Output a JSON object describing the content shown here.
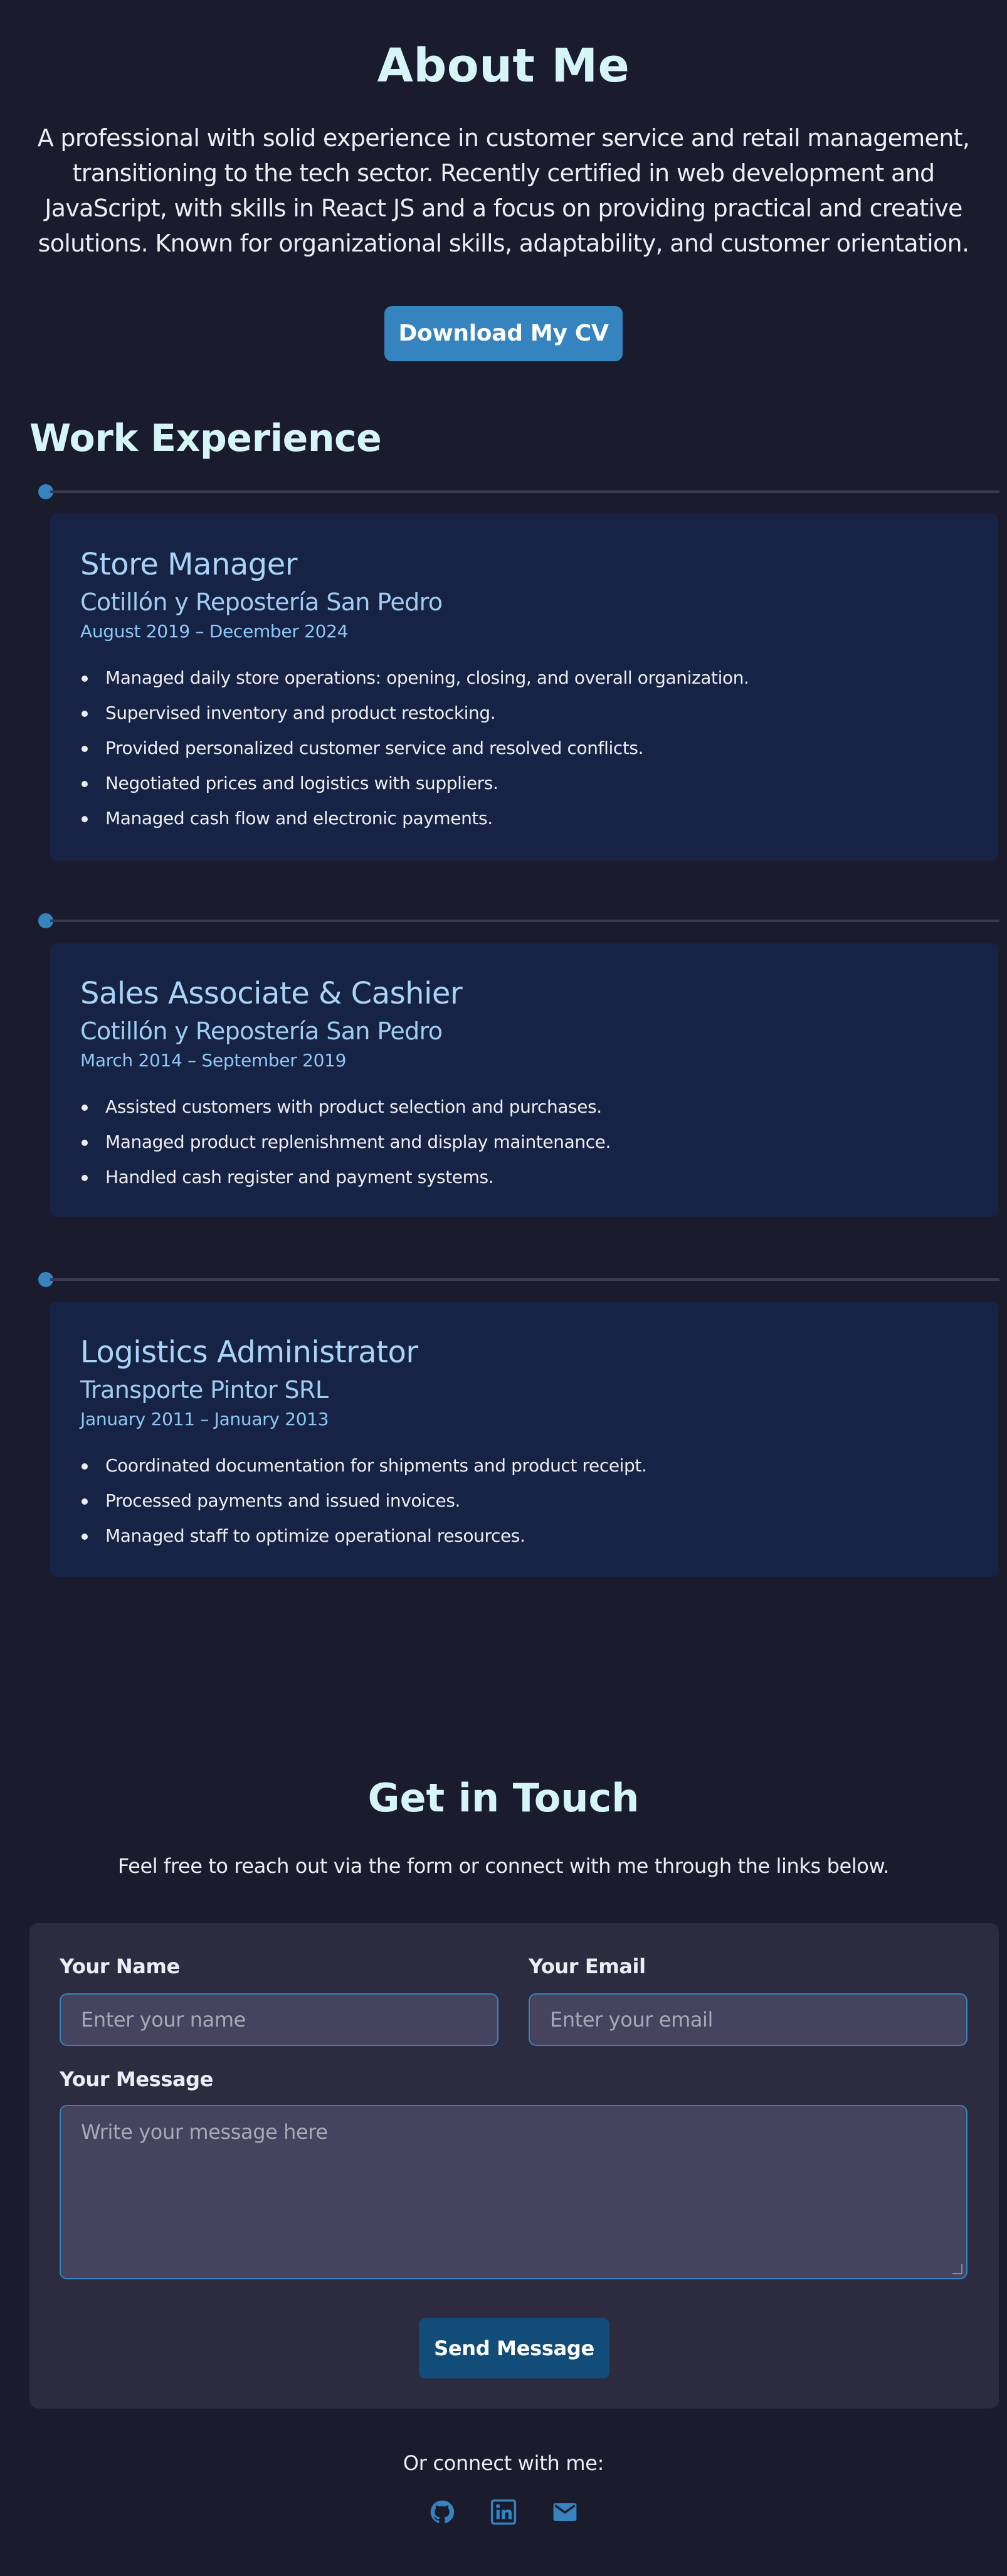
{
  "about": {
    "title": "About Me",
    "description": "A professional with solid experience in customer service and retail management, transitioning to the tech sector. Recently certified in web development and JavaScript, with skills in React JS and a focus on providing practical and creative solutions. Known for organizational skills, adaptability, and customer orientation.",
    "cv_button": "Download My CV"
  },
  "work": {
    "title": "Work Experience",
    "jobs": [
      {
        "role": "Store Manager",
        "company": "Cotillón y Repostería San Pedro",
        "dates": "August 2019 – December 2024",
        "duties": [
          "Managed daily store operations: opening, closing, and overall organization.",
          "Supervised inventory and product restocking.",
          "Provided personalized customer service and resolved conflicts.",
          "Negotiated prices and logistics with suppliers.",
          "Managed cash flow and electronic payments."
        ]
      },
      {
        "role": "Sales Associate & Cashier",
        "company": "Cotillón y Repostería San Pedro",
        "dates": "March 2014 – September 2019",
        "duties": [
          "Assisted customers with product selection and purchases.",
          "Managed product replenishment and display maintenance.",
          "Handled cash register and payment systems."
        ]
      },
      {
        "role": "Logistics Administrator",
        "company": "Transporte Pintor SRL",
        "dates": "January 2011 – January 2013",
        "duties": [
          "Coordinated documentation for shipments and product receipt.",
          "Processed payments and issued invoices.",
          "Managed staff to optimize operational resources."
        ]
      }
    ]
  },
  "contact": {
    "title": "Get in Touch",
    "subtitle": "Feel free to reach out via the form or connect with me through the links below.",
    "name_label": "Your Name",
    "name_placeholder": "Enter your name",
    "email_label": "Your Email",
    "email_placeholder": "Enter your email",
    "message_label": "Your Message",
    "message_placeholder": "Write your message here",
    "send_button": "Send Message",
    "connect_text": "Or connect with me:",
    "socials": [
      "github-icon",
      "linkedin-icon",
      "email-icon"
    ]
  },
  "colors": {
    "background": "#1b1b2e",
    "accent": "#3584bf",
    "heading": "#d6f5f7",
    "card": "#172345"
  }
}
